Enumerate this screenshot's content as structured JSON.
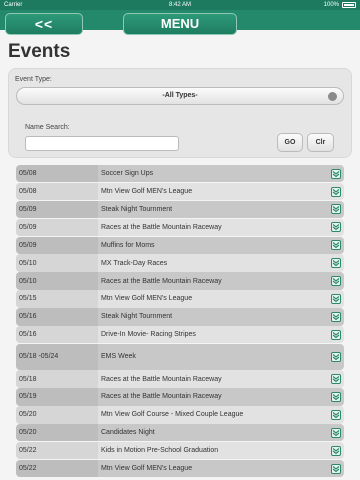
{
  "status": {
    "carrier": "Carrier",
    "time": "8:42 AM",
    "battery": "100%"
  },
  "nav": {
    "back_label": "<<",
    "menu_label": "MENU"
  },
  "page": {
    "title": "Events"
  },
  "filters": {
    "event_type_label": "Event Type:",
    "event_type_value": "-All Types-",
    "name_search_label": "Name Search:",
    "name_search_value": "",
    "go_label": "GO",
    "clr_label": "Clr"
  },
  "events": [
    {
      "date": "05/08",
      "name": "Soccer Sign Ups"
    },
    {
      "date": "05/08",
      "name": "Mtn View Golf MEN's League"
    },
    {
      "date": "05/09",
      "name": "Steak Night Tournment"
    },
    {
      "date": "05/09",
      "name": "Races at the Battle Mountain Raceway"
    },
    {
      "date": "05/09",
      "name": "Muffins for Moms"
    },
    {
      "date": "05/10",
      "name": "MX Track-Day Races"
    },
    {
      "date": "05/10",
      "name": "Races at the Battle Mountain Raceway"
    },
    {
      "date": "05/15",
      "name": "Mtn View Golf MEN's League"
    },
    {
      "date": "05/16",
      "name": "Steak Night Tournment"
    },
    {
      "date": "05/16",
      "name": "Drive-In Movie- Racing Stripes"
    },
    {
      "date": "05/18 -05/24",
      "name": "EMS Week"
    },
    {
      "date": "05/18",
      "name": "Races at the Battle Mountain Raceway"
    },
    {
      "date": "05/19",
      "name": "Races at the Battle Mountain Raceway"
    },
    {
      "date": "05/20",
      "name": "Mtn View Golf Course - Mixed Couple League"
    },
    {
      "date": "05/20",
      "name": "Candidates Night"
    },
    {
      "date": "05/22",
      "name": "Kids in Motion Pre-School Graduation"
    },
    {
      "date": "05/22",
      "name": "Mtn View Golf MEN's League"
    }
  ]
}
